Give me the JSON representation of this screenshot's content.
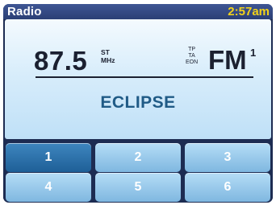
{
  "header": {
    "title": "Radio",
    "time": "2:57am"
  },
  "display": {
    "frequency": "87.5",
    "stereo": "ST",
    "unit": "MHz",
    "flags": [
      "TP",
      "TA",
      "EON"
    ],
    "band": "FM",
    "band_number": "1",
    "station": "ECLIPSE"
  },
  "presets": [
    {
      "label": "1",
      "selected": true
    },
    {
      "label": "2",
      "selected": false
    },
    {
      "label": "3",
      "selected": false
    },
    {
      "label": "4",
      "selected": false
    },
    {
      "label": "5",
      "selected": false
    },
    {
      "label": "6",
      "selected": false
    }
  ],
  "colors": {
    "title_bar": "#2f447c",
    "clock_text": "#f2d21a",
    "station_text": "#205b86",
    "preset_selected": "#2a6fa8",
    "preset_default": "#9ccaec"
  }
}
